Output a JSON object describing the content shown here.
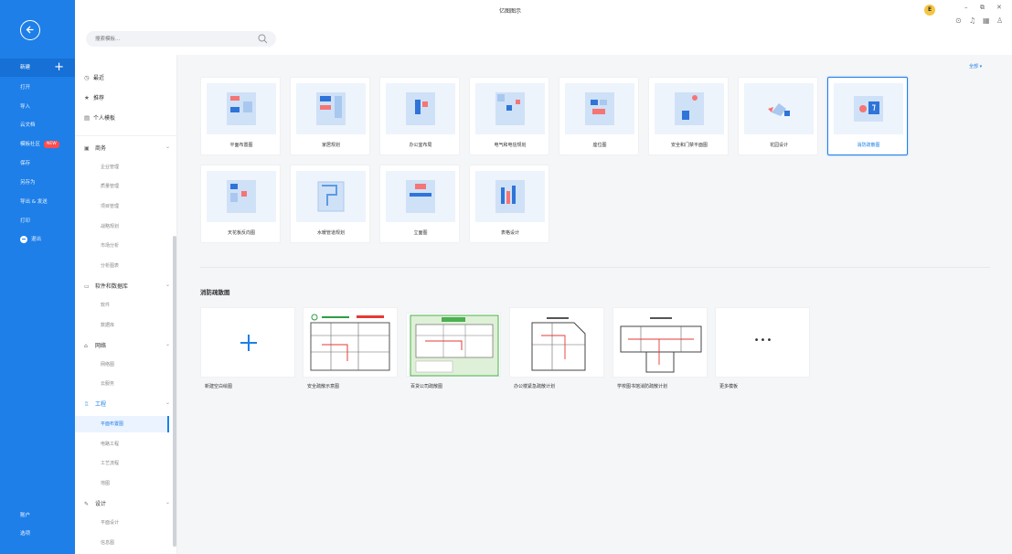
{
  "app": {
    "title": "亿图图示"
  },
  "search": {
    "placeholder": "搜索模板..."
  },
  "user": {
    "avatar_letter": "E"
  },
  "window": {
    "minimize": "–",
    "restore": "⧉",
    "close": "✕"
  },
  "toolbar_icons": [
    "help-icon",
    "bell-icon",
    "apps-icon",
    "shirt-icon"
  ],
  "leftbar": {
    "items": [
      {
        "label": "新建",
        "plus": "+"
      },
      {
        "label": "打开"
      },
      {
        "label": "导入"
      },
      {
        "label": "云文档"
      },
      {
        "label": "模板社区",
        "badge": "NEW"
      },
      {
        "label": "保存"
      },
      {
        "label": "另存为"
      },
      {
        "label": "导出 & 发送"
      },
      {
        "label": "打印"
      },
      {
        "label": "退出"
      }
    ],
    "bottom": [
      {
        "label": "账户"
      },
      {
        "label": "选项"
      }
    ]
  },
  "categories": {
    "top": [
      {
        "icon": "clock-icon",
        "label": "最近"
      },
      {
        "icon": "star-icon",
        "label": "推荐"
      },
      {
        "icon": "user-template-icon",
        "label": "个人模板"
      }
    ],
    "groups": [
      {
        "label": "商务",
        "subs": [
          "企业管理",
          "质量管理",
          "项目管理",
          "战略规划",
          "市场分析",
          "分析图表"
        ]
      },
      {
        "label": "软件和数据库",
        "subs": [
          "软件",
          "数据库"
        ]
      },
      {
        "label": "网络",
        "subs": [
          "网络图",
          "云服务"
        ]
      },
      {
        "label": "工程",
        "subs": [
          "平面布置图",
          "电路工程",
          "工艺流程",
          "地图"
        ]
      },
      {
        "label": "设计",
        "subs": [
          "平面设计",
          "信息图"
        ]
      }
    ],
    "active_sub": "平面布置图"
  },
  "main": {
    "all_label": "全部 ▾",
    "templates": [
      {
        "label": "平面布置图"
      },
      {
        "label": "家居规划"
      },
      {
        "label": "办公室布局"
      },
      {
        "label": "电气和电信规划"
      },
      {
        "label": "座位图"
      },
      {
        "label": "安全和门禁平面图"
      },
      {
        "label": "花园设计"
      },
      {
        "label": "消防疏散图",
        "selected": true
      },
      {
        "label": "天花板反向图"
      },
      {
        "label": "水暖管道规划"
      },
      {
        "label": "立面图"
      },
      {
        "label": "表格设计"
      }
    ],
    "section_title": "消防疏散图",
    "section_cards": [
      {
        "label": "新建空白绘图"
      },
      {
        "label": "安全疏散示意图"
      },
      {
        "label": "百货公司疏散图"
      },
      {
        "label": "办公楼紧急疏散计划"
      },
      {
        "label": "学校图书馆消防疏散计划"
      },
      {
        "label": "更多模板",
        "dots": "•••"
      }
    ]
  },
  "colors": {
    "accent": "#1e7fe8",
    "sidebar": "#1e7fe8",
    "badge": "#ff4d4f"
  }
}
